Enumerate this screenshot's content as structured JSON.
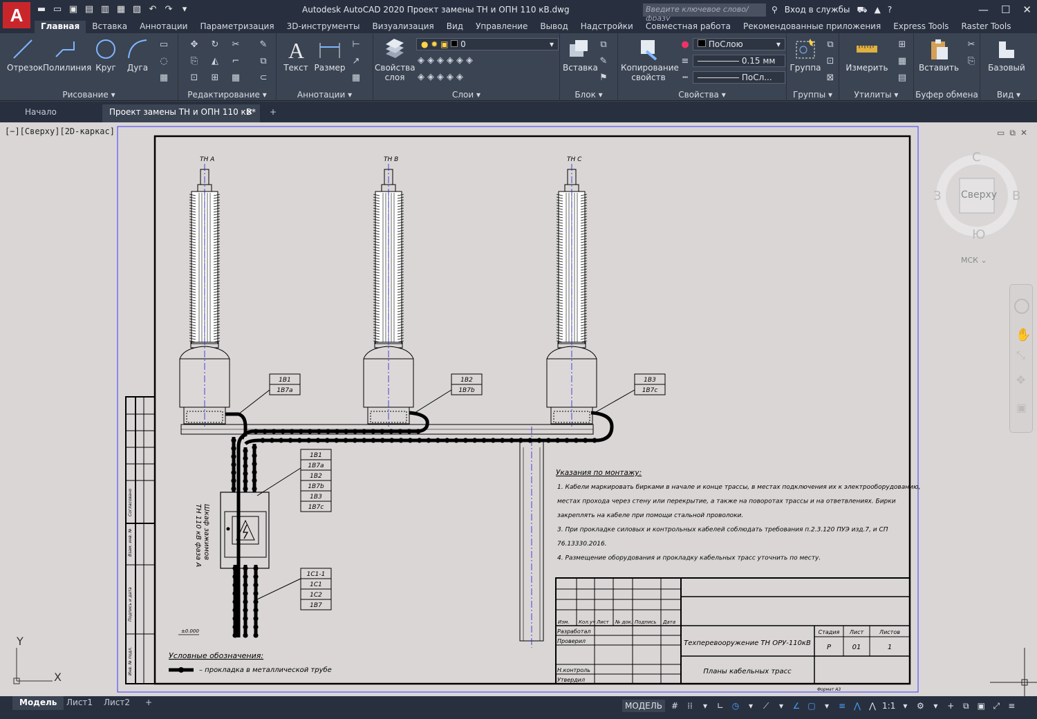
{
  "app": {
    "logo": "A",
    "title": "Autodesk AutoCAD 2020   Проект замены ТН и ОПН 110 кВ.dwg",
    "search_placeholder": "Введите ключевое слово/фразу",
    "sign_in": "Вход в службы",
    "accent": "#c9262c"
  },
  "ribbon_tabs": [
    "Главная",
    "Вставка",
    "Аннотации",
    "Параметризация",
    "3D-инструменты",
    "Визуализация",
    "Вид",
    "Управление",
    "Вывод",
    "Надстройки",
    "Совместная работа",
    "Рекомендованные приложения",
    "Express Tools",
    "Raster Tools"
  ],
  "panels": {
    "draw": {
      "title": "Рисование",
      "line": "Отрезок",
      "polyline": "Полилиния",
      "circle": "Круг",
      "arc": "Дуга"
    },
    "modify": {
      "title": "Редактирование"
    },
    "annotation": {
      "title": "Аннотации",
      "text": "Текст",
      "dimension": "Размер"
    },
    "layers": {
      "title": "Слои",
      "props_l1": "Свойства",
      "props_l2": "слоя",
      "current": "0"
    },
    "block": {
      "title": "Блок",
      "insert": "Вставка"
    },
    "properties": {
      "title": "Свойства",
      "match_l1": "Копирование",
      "match_l2": "свойств",
      "color": "ПоСлою",
      "lineweight": "0.15 мм",
      "linetype": "ПоСл..."
    },
    "groups": {
      "title": "Группы",
      "group": "Группа"
    },
    "utilities": {
      "title": "Утилиты",
      "measure": "Измерить"
    },
    "clipboard": {
      "title": "Буфер обмена",
      "paste": "Вставить"
    },
    "view": {
      "title": "Вид",
      "base": "Базовый"
    }
  },
  "doc_tabs": {
    "start": "Начало",
    "current": "Проект замены ТН и ОПН 110 кВ*"
  },
  "viewport": {
    "label": "[−][Сверху][2D-каркас]"
  },
  "viewcube": {
    "n": "С",
    "s": "Ю",
    "w": "З",
    "e": "В",
    "face": "Сверху",
    "ucs": "МСК"
  },
  "drawing": {
    "phase_labels": [
      "ТН А",
      "ТН В",
      "ТН С"
    ],
    "cable_tags": [
      [
        "1В1",
        "1В7а"
      ],
      [
        "1В2",
        "1В7b"
      ],
      [
        "1В3",
        "1В7с"
      ]
    ],
    "bundle_upper": [
      "1В1",
      "1В7а",
      "1В2",
      "1В7b",
      "1В3",
      "1В7с"
    ],
    "bundle_lower": [
      "1С1-1",
      "1С1",
      "1С2",
      "1В7"
    ],
    "cabinet_label_1": "Шкаф зажимов",
    "cabinet_label_2": "ТН 110 кВ фаза А",
    "elev_mark": "±0.000",
    "legend_title": "Условные обозначения:",
    "legend_item": "– прокладка в металлической трубе",
    "notes_title": "Указания по монтажу:",
    "notes": [
      "1.  Кабели маркировать бирками в начале и конце трассы, в местах подключения их к электрооборудованию,",
      "     местах прохода через стену или перекрытие, а также на поворотах трассы и на ответвлениях. Бирки",
      "     закреплять на кабеле при помощи стальной проволоки.",
      "3.  При прокладке силовых и контрольных кабелей соблюдать требования п.2.3.120 ПУЭ изд.7, и СП",
      "     76.13330.2016.",
      "4.  Размещение оборудования и прокладку кабельных трасс уточнить по месту."
    ],
    "stamp": {
      "hdr": [
        "Изм.",
        "Кол.уч",
        "Лист",
        "№ док.",
        "Подпись",
        "Дата"
      ],
      "dev": "Разработал",
      "chk": "Проверил",
      "nk": "Н.контроль",
      "appr": "Утвердил",
      "title1": "Техперевооружение ТН ОРУ-110кВ",
      "title2": "Планы кабельных трасс",
      "stage_h": "Стадия",
      "sheet_h": "Лист",
      "sheets_h": "Листов",
      "stage": "Р",
      "sheet": "01",
      "sheets": "1",
      "format": "Формат А3"
    },
    "side_cells": [
      "Инв. № подл.",
      "Подпись и дата",
      "Взам. инв. №",
      "Согласовано"
    ],
    "ucs_x": "X",
    "ucs_y": "Y"
  },
  "layout_tabs": [
    "Модель",
    "Лист1",
    "Лист2"
  ],
  "status": {
    "model": "МОДЕЛЬ",
    "scale": "1:1"
  }
}
